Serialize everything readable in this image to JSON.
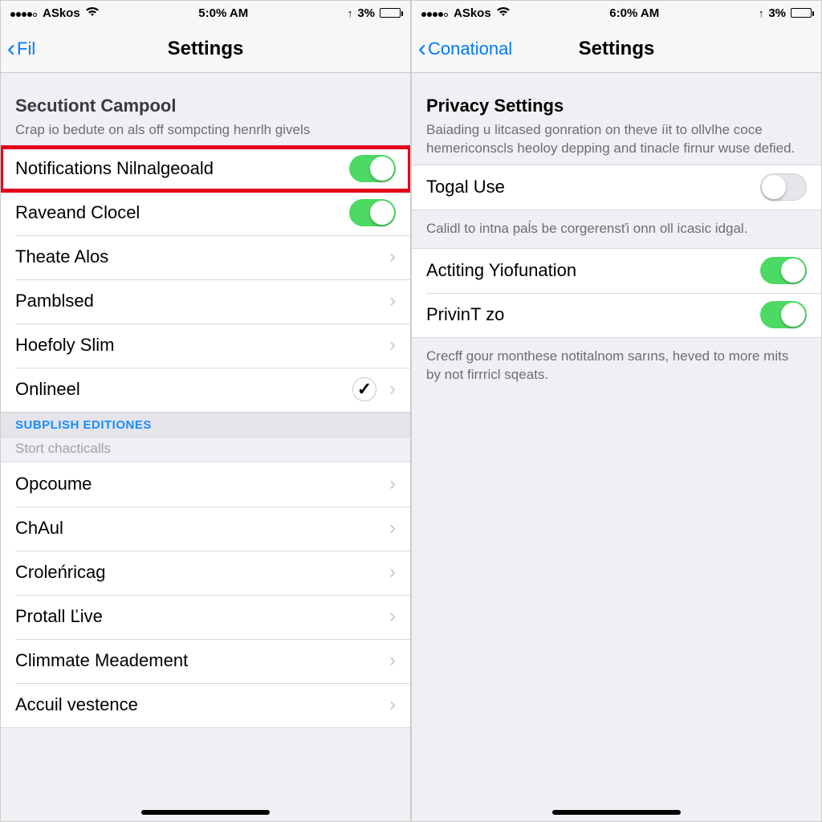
{
  "left": {
    "status": {
      "carrier": "ASkos",
      "time": "5:0% AM",
      "battery": "3%"
    },
    "nav": {
      "back": "Fil",
      "title": "Settings"
    },
    "section1": {
      "title": "Secutiont Campool",
      "desc": "Crap io bedute on als off sompcting henrlh givels"
    },
    "rows1": [
      {
        "label": "Notifications Nilnalgeoald",
        "type": "toggle",
        "on": true,
        "hl": true
      },
      {
        "label": "Raveand Clocel",
        "type": "toggle",
        "on": true
      },
      {
        "label": "Theate Alos",
        "type": "chev"
      },
      {
        "label": "Pamblsed",
        "type": "chev"
      },
      {
        "label": "Hoefoly Slim",
        "type": "chev"
      },
      {
        "label": "Onlineel",
        "type": "check-chev"
      }
    ],
    "section2_header": "SUBPLISH EDITIONES",
    "section2_note": "Stort chacticalls",
    "rows2": [
      {
        "label": "Opcoume",
        "type": "chev"
      },
      {
        "label": "ChAul",
        "type": "chev"
      },
      {
        "label": "Croleńricag",
        "type": "chev"
      },
      {
        "label": "Protall Ľive",
        "type": "chev"
      },
      {
        "label": "Climmate Meadement",
        "type": "chev"
      },
      {
        "label": "Accuil vestence",
        "type": "chev"
      }
    ]
  },
  "right": {
    "status": {
      "carrier": "ASkos",
      "time": "6:0% AM",
      "battery": "3%"
    },
    "nav": {
      "back": "Conational",
      "title": "Settings"
    },
    "section1": {
      "title": "Privacy Settings",
      "desc": "Baiading u litcased gonration on theve íit to ollvlhe coce hemericonscls heoloy depping and tinacle firnur wuse defied."
    },
    "rows1": [
      {
        "label": "Togal Use",
        "type": "toggle",
        "on": false
      }
    ],
    "footer1": "Calidl to intna paĺs be corgerensťi onn oll icasic idgal.",
    "rows2": [
      {
        "label": "Actiting Yiofunation",
        "type": "toggle",
        "on": true
      },
      {
        "label": "PrivinT zo",
        "type": "toggle",
        "on": true
      }
    ],
    "footer2": "Crecff gour monthese notitalnom sarıns, heved to more mits by not firrricl sqeats."
  }
}
